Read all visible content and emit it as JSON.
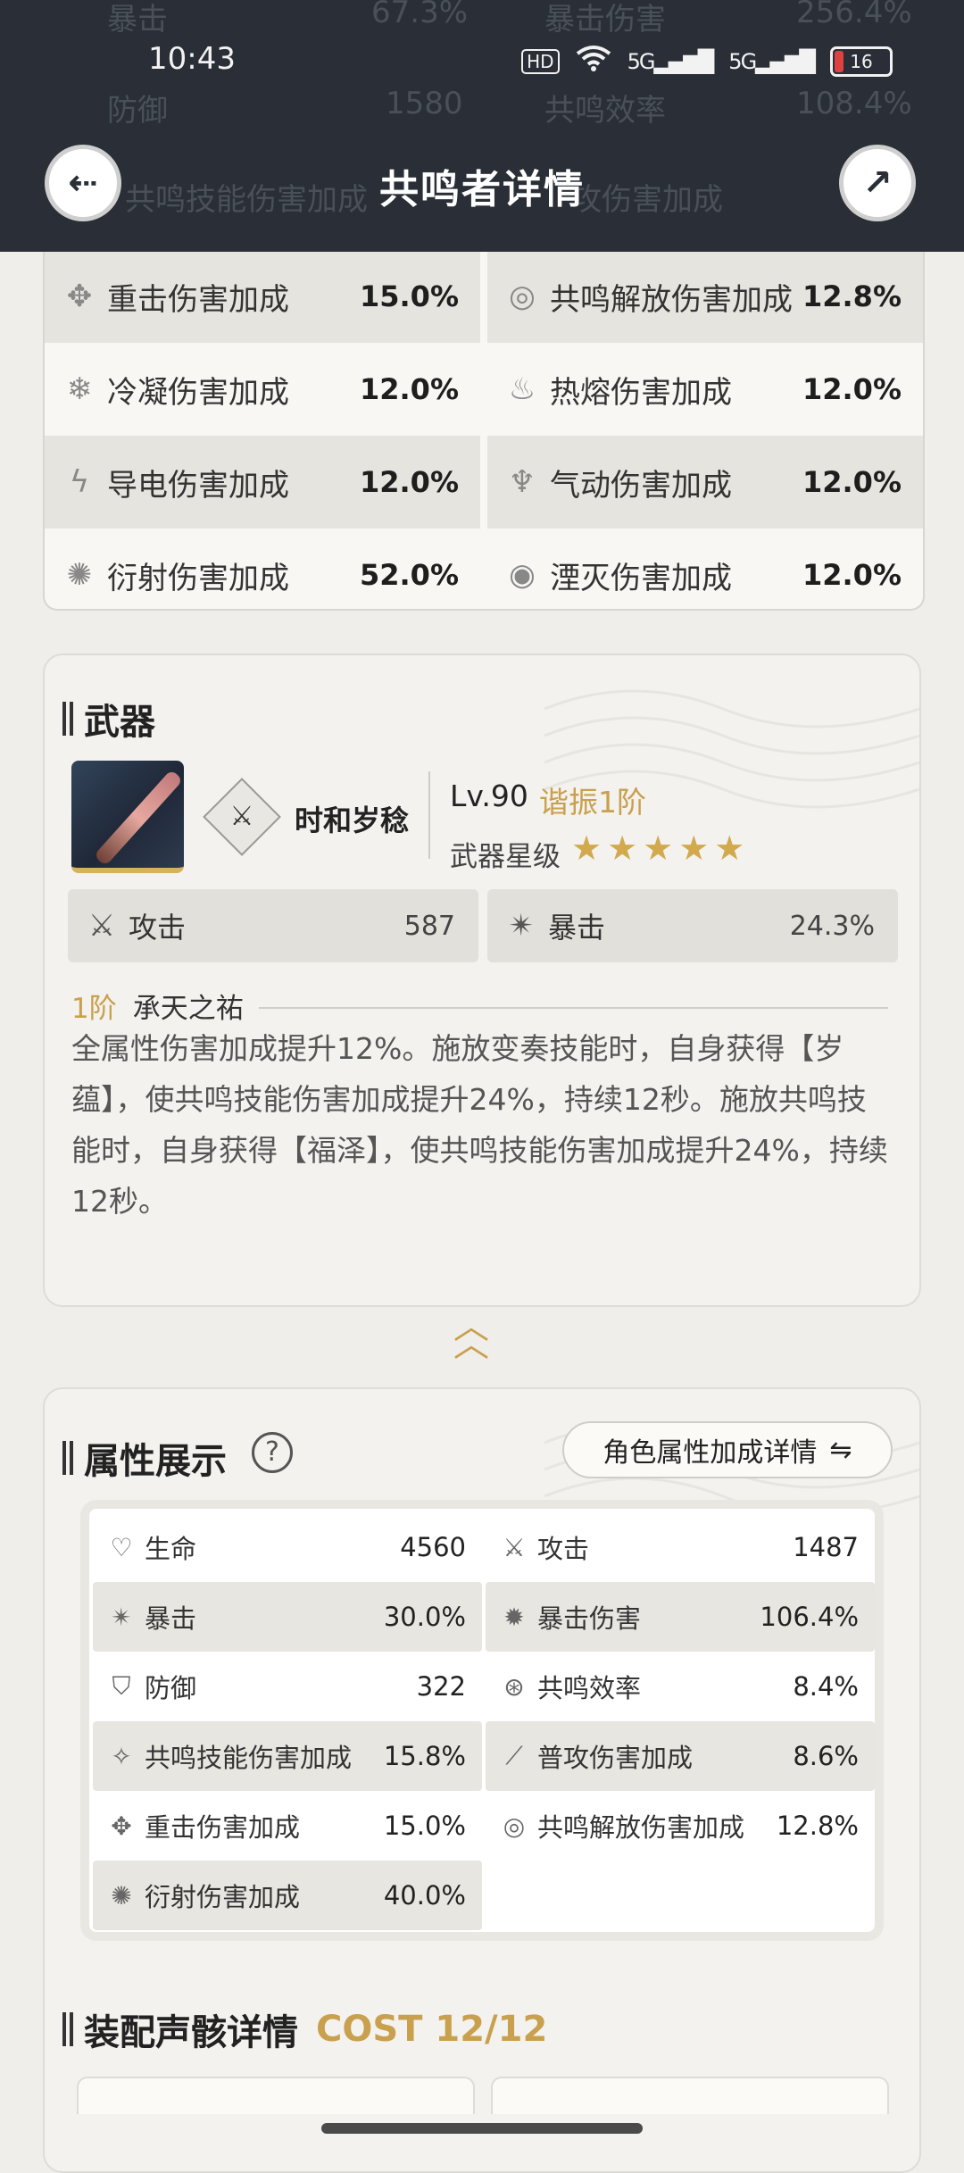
{
  "status_bar": {
    "time": "10:43",
    "hd": "HD",
    "net_a": "5G",
    "net_b": "5G",
    "battery": "16"
  },
  "header": {
    "title": "共鸣者详情",
    "ghost_rows": [
      {
        "l1": "暴击",
        "v1": "67.3%",
        "l2": "暴击伤害",
        "v2": "256.4%"
      },
      {
        "l1": "防御",
        "v1": "1580",
        "l2": "共鸣效率",
        "v2": "108.4%"
      },
      {
        "l1": "共鸣技能伤害加成",
        "v1": "",
        "l2": "攻伤害加成",
        "v2": ""
      }
    ]
  },
  "top_stats": [
    {
      "left_label": "重击伤害加成",
      "left_value": "15.0%",
      "right_label": "共鸣解放伤害加成",
      "right_value": "12.8%"
    },
    {
      "left_label": "冷凝伤害加成",
      "left_value": "12.0%",
      "right_label": "热熔伤害加成",
      "right_value": "12.0%"
    },
    {
      "left_label": "导电伤害加成",
      "left_value": "12.0%",
      "right_label": "气动伤害加成",
      "right_value": "12.0%"
    },
    {
      "left_label": "衍射伤害加成",
      "left_value": "52.0%",
      "right_label": "湮灭伤害加成",
      "right_value": "12.0%"
    }
  ],
  "weapon": {
    "section_title": "武器",
    "name": "时和岁稔",
    "level": "Lv.90",
    "refinement": "谐振1阶",
    "star_label": "武器星级",
    "stars": "★★★★★",
    "stat1_label": "攻击",
    "stat1_value": "587",
    "stat2_label": "暴击",
    "stat2_value": "24.3%",
    "rank": "1阶",
    "passive_name": "承天之祐",
    "description": "全属性伤害加成提升12%。施放变奏技能时，自身获得【岁蕴】，使共鸣技能伤害加成提升24%，持续12秒。施放共鸣技能时，自身获得【福泽】，使共鸣技能伤害加成提升24%，持续12秒。"
  },
  "attributes": {
    "section_title": "属性展示",
    "help": "?",
    "detail_button": "角色属性加成详情",
    "rows": [
      {
        "l_label": "生命",
        "l_value": "4560",
        "r_label": "攻击",
        "r_value": "1487"
      },
      {
        "l_label": "暴击",
        "l_value": "30.0%",
        "r_label": "暴击伤害",
        "r_value": "106.4%"
      },
      {
        "l_label": "防御",
        "l_value": "322",
        "r_label": "共鸣效率",
        "r_value": "8.4%"
      },
      {
        "l_label": "共鸣技能伤害加成",
        "l_value": "15.8%",
        "r_label": "普攻伤害加成",
        "r_value": "8.6%"
      },
      {
        "l_label": "重击伤害加成",
        "l_value": "15.0%",
        "r_label": "共鸣解放伤害加成",
        "r_value": "12.8%"
      },
      {
        "l_label": "衍射伤害加成",
        "l_value": "40.0%",
        "r_label": "",
        "r_value": ""
      }
    ]
  },
  "echo": {
    "section_title": "装配声骸详情",
    "cost": "COST 12/12"
  },
  "colors": {
    "header_bg": "#2a2f37",
    "accent_gold": "#c9a04d",
    "page_bg": "#efeeeb"
  },
  "icons": {
    "back": "back-arrow-icon",
    "share": "share-arrow-icon"
  }
}
